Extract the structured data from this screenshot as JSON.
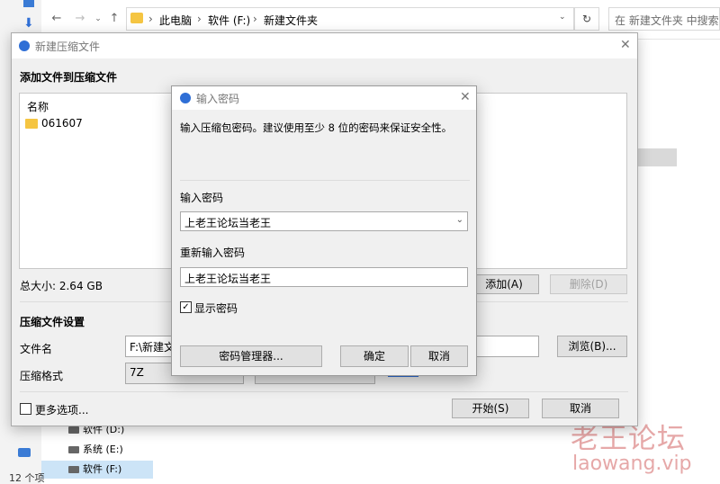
{
  "explorer": {
    "breadcrumb": [
      "此电脑",
      "软件 (F:)",
      "新建文件夹"
    ],
    "search_placeholder": "在 新建文件夹 中搜索",
    "tree_items": [
      "软件 (D:)",
      "系统 (E:)",
      "软件 (F:)"
    ],
    "status_left": "12 个项"
  },
  "main_dialog": {
    "title": "新建压缩文件",
    "add_files_heading": "添加文件到压缩文件",
    "list_header": "名称",
    "files": [
      {
        "name": "061607"
      }
    ],
    "total_size": "总大小: 2.64 GB",
    "add_button": "添加(A)",
    "delete_button": "删除(D)",
    "settings_heading": "压缩文件设置",
    "filename_label": "文件名",
    "filename_value": "F:\\新建文件",
    "browse_button": "浏览(B)...",
    "format_label": "压缩格式",
    "format_value": "7Z",
    "more_options_label": "更多选项...",
    "start_button": "开始(S)",
    "cancel_button": "取消"
  },
  "password_dialog": {
    "title": "输入密码",
    "description": "输入压缩包密码。建议使用至少 8 位的密码来保证安全性。",
    "password_label": "输入密码",
    "password_value": "上老王论坛当老王",
    "reenter_label": "重新输入密码",
    "reenter_value": "上老王论坛当老王",
    "show_password_label": "显示密码",
    "show_password_checked": true,
    "manager_button": "密码管理器...",
    "ok_button": "确定",
    "cancel_button": "取消"
  },
  "watermark": {
    "text_cn": "老王论坛",
    "text_en": "laowang.vip"
  },
  "colors": {
    "accent": "#2f6fd6",
    "folder": "#f5c542",
    "watermark": "#e6a8a8"
  }
}
